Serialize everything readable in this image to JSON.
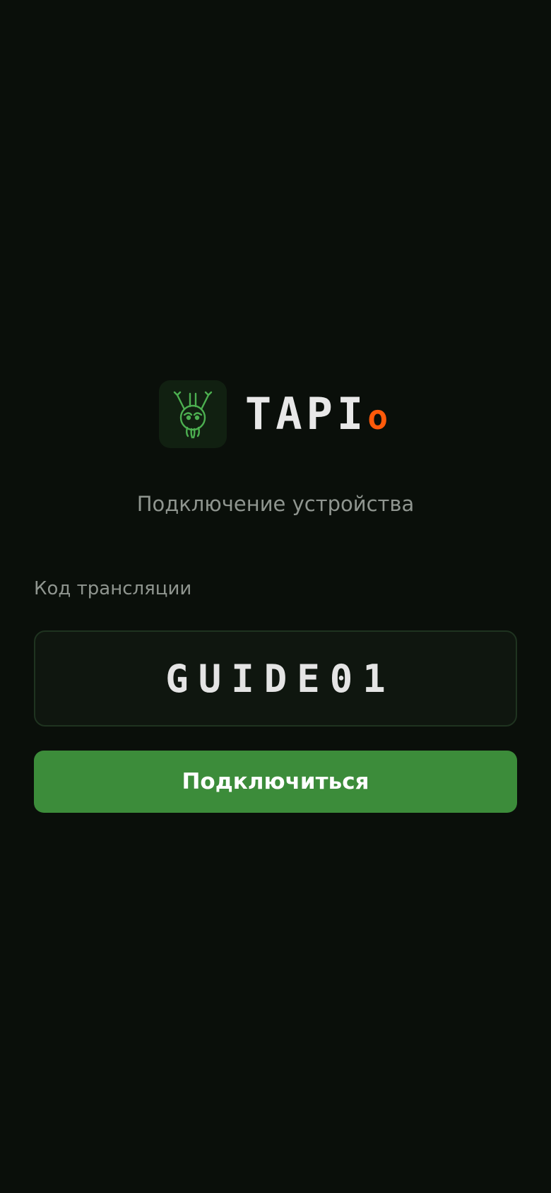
{
  "brand": {
    "name": "TAPI",
    "accent_letter": "o",
    "accent_color": "#ff5a0a",
    "logo_icon": "skull-antlers-icon"
  },
  "screen": {
    "subtitle": "Подключение устройства"
  },
  "form": {
    "code_label": "Код трансляции",
    "code_value": "GUIDE01",
    "connect_label": "Подключиться"
  },
  "colors": {
    "background": "#0a0f0a",
    "primary_button": "#3c8c3a",
    "logo_stroke": "#4caf50"
  }
}
